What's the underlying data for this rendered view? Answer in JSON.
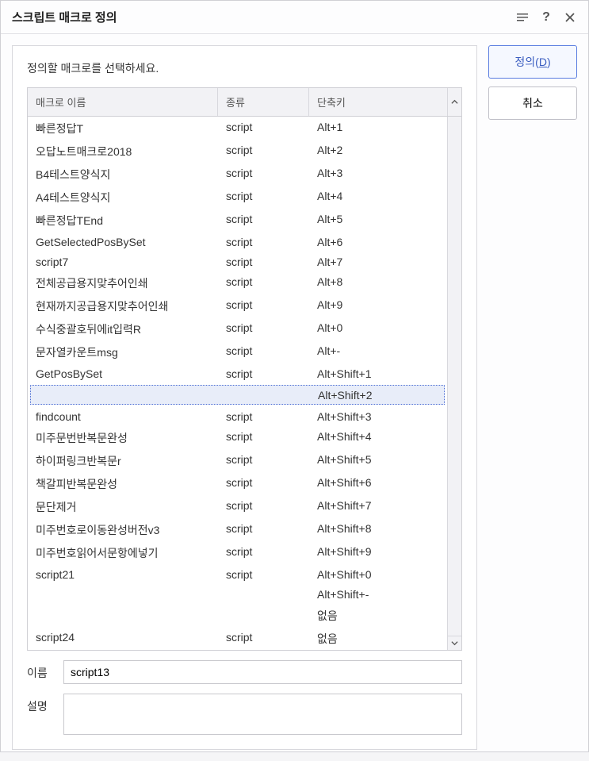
{
  "title": "스크립트 매크로 정의",
  "instruction": "정의할 매크로를 선택하세요.",
  "columns": {
    "name": "매크로 이름",
    "type": "종류",
    "shortcut": "단축키"
  },
  "rows": [
    {
      "name": "빠른정답T",
      "type": "script",
      "shortcut": "Alt+1",
      "selected": false
    },
    {
      "name": "오답노트매크로2018",
      "type": "script",
      "shortcut": "Alt+2",
      "selected": false
    },
    {
      "name": "B4테스트양식지",
      "type": "script",
      "shortcut": "Alt+3",
      "selected": false
    },
    {
      "name": "A4테스트양식지",
      "type": "script",
      "shortcut": "Alt+4",
      "selected": false
    },
    {
      "name": "빠른정답TEnd",
      "type": "script",
      "shortcut": "Alt+5",
      "selected": false
    },
    {
      "name": "GetSelectedPosBySet",
      "type": "script",
      "shortcut": "Alt+6",
      "selected": false
    },
    {
      "name": "script7",
      "type": "script",
      "shortcut": "Alt+7",
      "selected": false
    },
    {
      "name": "전체공급용지맞추어인쇄",
      "type": "script",
      "shortcut": "Alt+8",
      "selected": false
    },
    {
      "name": "현재까지공급용지맞추어인쇄",
      "type": "script",
      "shortcut": "Alt+9",
      "selected": false
    },
    {
      "name": "수식중괄호뒤에it입력R",
      "type": "script",
      "shortcut": "Alt+0",
      "selected": false
    },
    {
      "name": "문자열카운트msg",
      "type": "script",
      "shortcut": "Alt+-",
      "selected": false
    },
    {
      "name": "GetPosBySet",
      "type": "script",
      "shortcut": "Alt+Shift+1",
      "selected": false
    },
    {
      "name": "",
      "type": "",
      "shortcut": "Alt+Shift+2",
      "selected": true
    },
    {
      "name": "findcount",
      "type": "script",
      "shortcut": "Alt+Shift+3",
      "selected": false
    },
    {
      "name": "미주문번반복문완성",
      "type": "script",
      "shortcut": "Alt+Shift+4",
      "selected": false
    },
    {
      "name": "하이퍼링크반복문r",
      "type": "script",
      "shortcut": "Alt+Shift+5",
      "selected": false
    },
    {
      "name": "책갈피반복문완성",
      "type": "script",
      "shortcut": "Alt+Shift+6",
      "selected": false
    },
    {
      "name": "문단제거",
      "type": "script",
      "shortcut": "Alt+Shift+7",
      "selected": false
    },
    {
      "name": "미주번호로이동완성버전v3",
      "type": "script",
      "shortcut": "Alt+Shift+8",
      "selected": false
    },
    {
      "name": "미주번호읽어서문항에넣기",
      "type": "script",
      "shortcut": "Alt+Shift+9",
      "selected": false
    },
    {
      "name": "script21",
      "type": "script",
      "shortcut": "Alt+Shift+0",
      "selected": false
    },
    {
      "name": "",
      "type": "",
      "shortcut": "Alt+Shift+-",
      "selected": false
    },
    {
      "name": "",
      "type": "",
      "shortcut": "없음",
      "selected": false
    },
    {
      "name": "script24",
      "type": "script",
      "shortcut": "없음",
      "selected": false
    }
  ],
  "fields": {
    "name_label": "이름",
    "name_value": "script13",
    "desc_label": "설명",
    "desc_value": ""
  },
  "buttons": {
    "define": "정의",
    "define_hotkey": "D",
    "cancel": "취소"
  }
}
